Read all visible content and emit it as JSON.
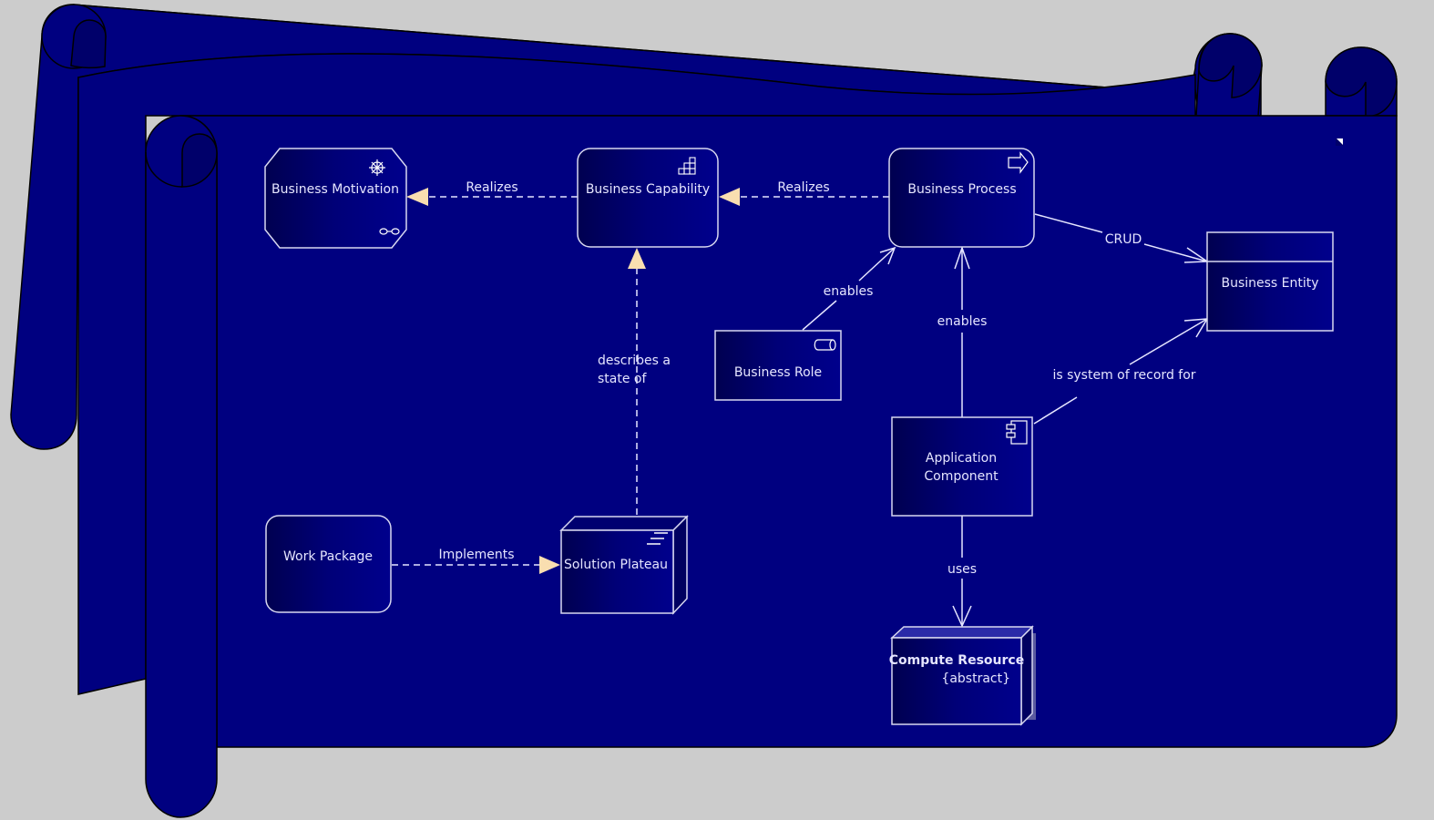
{
  "diagram": {
    "title": "",
    "colors": {
      "background": "#cccccc",
      "scroll": "#000080",
      "scroll_dark": "#00006a",
      "node_fill_dark": "#000055",
      "node_fill_light": "#00008a",
      "node_stroke": "#d8d8f0",
      "arrow_fill": "#f9deb0",
      "text": "#e6e6ff"
    },
    "nodes": {
      "business_motivation": {
        "label": "Business Motivation",
        "icon": "wheel-icon"
      },
      "business_capability": {
        "label": "Business Capability",
        "icon": "capability-icon"
      },
      "business_process": {
        "label": "Business Process",
        "icon": "process-arrow-icon"
      },
      "business_entity": {
        "label": "Business Entity"
      },
      "business_role": {
        "label": "Business Role",
        "icon": "role-icon"
      },
      "application_component": {
        "label_line1": "Application",
        "label_line2": "Component",
        "icon": "component-icon"
      },
      "work_package": {
        "label": "Work Package"
      },
      "solution_plateau": {
        "label": "Solution Plateau",
        "icon": "plateau-icon"
      },
      "compute_resource": {
        "label": "Compute Resource",
        "stereotype": "{abstract}"
      }
    },
    "edges": {
      "capability_realizes_motivation": {
        "label": "Realizes",
        "type": "realization"
      },
      "process_realizes_capability": {
        "label": "Realizes",
        "type": "realization"
      },
      "plateau_describes_capability": {
        "label_line1": "describes a",
        "label_line2": "state of",
        "type": "realization"
      },
      "process_crud_entity": {
        "label": "CRUD",
        "type": "association"
      },
      "role_enables_process": {
        "label": "enables",
        "type": "association"
      },
      "component_enables_process": {
        "label": "enables",
        "type": "association"
      },
      "component_record_entity": {
        "label": "is system of record for",
        "type": "association"
      },
      "workpackage_implements_plateau": {
        "label": "Implements",
        "type": "realization"
      },
      "component_uses_compute": {
        "label": "uses",
        "type": "association"
      }
    }
  }
}
